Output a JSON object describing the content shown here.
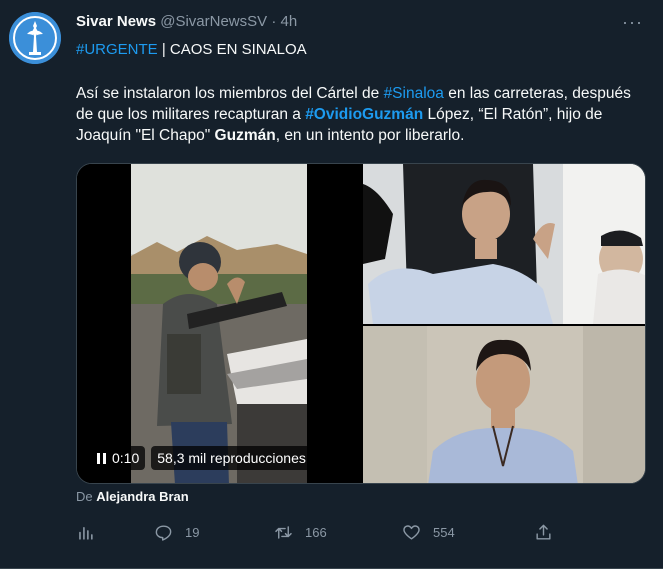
{
  "tweet": {
    "author": {
      "name": "Sivar News",
      "handle": "@SivarNewsSV",
      "separator": "·",
      "time": "4h"
    },
    "more_label": "···",
    "line1": {
      "hashtag": "#URGENTE",
      "rest": " | CAOS EN SINALOA"
    },
    "body": {
      "t1": "Así se instalaron los miembros del Cártel de ",
      "tag1": "#Sinaloa",
      "t2": " en las carreteras, después de que los militares recapturan a ",
      "tag2": "#OvidioGuzmán",
      "t3": " López, “El Ratón”, hijo de Joaquín \"El Chapo\" ",
      "bold": "Guzmán",
      "t4": ", en un intento por liberarlo."
    },
    "media": {
      "video_time": "0:10",
      "views": "58,3 mil reproducciones"
    },
    "credit": {
      "prefix": "De ",
      "who": "Alejandra Bran"
    },
    "actions": {
      "replies": "19",
      "retweets": "166",
      "likes": "554"
    }
  },
  "colors": {
    "background": "#15202b",
    "text": "#f7f9f9",
    "secondary": "#8b98a5",
    "link": "#1d9bf0",
    "border": "#38444d"
  },
  "icons": [
    "avatar-logo",
    "more-icon",
    "pause-icon",
    "analytics-icon",
    "reply-icon",
    "retweet-icon",
    "like-icon",
    "share-icon"
  ]
}
